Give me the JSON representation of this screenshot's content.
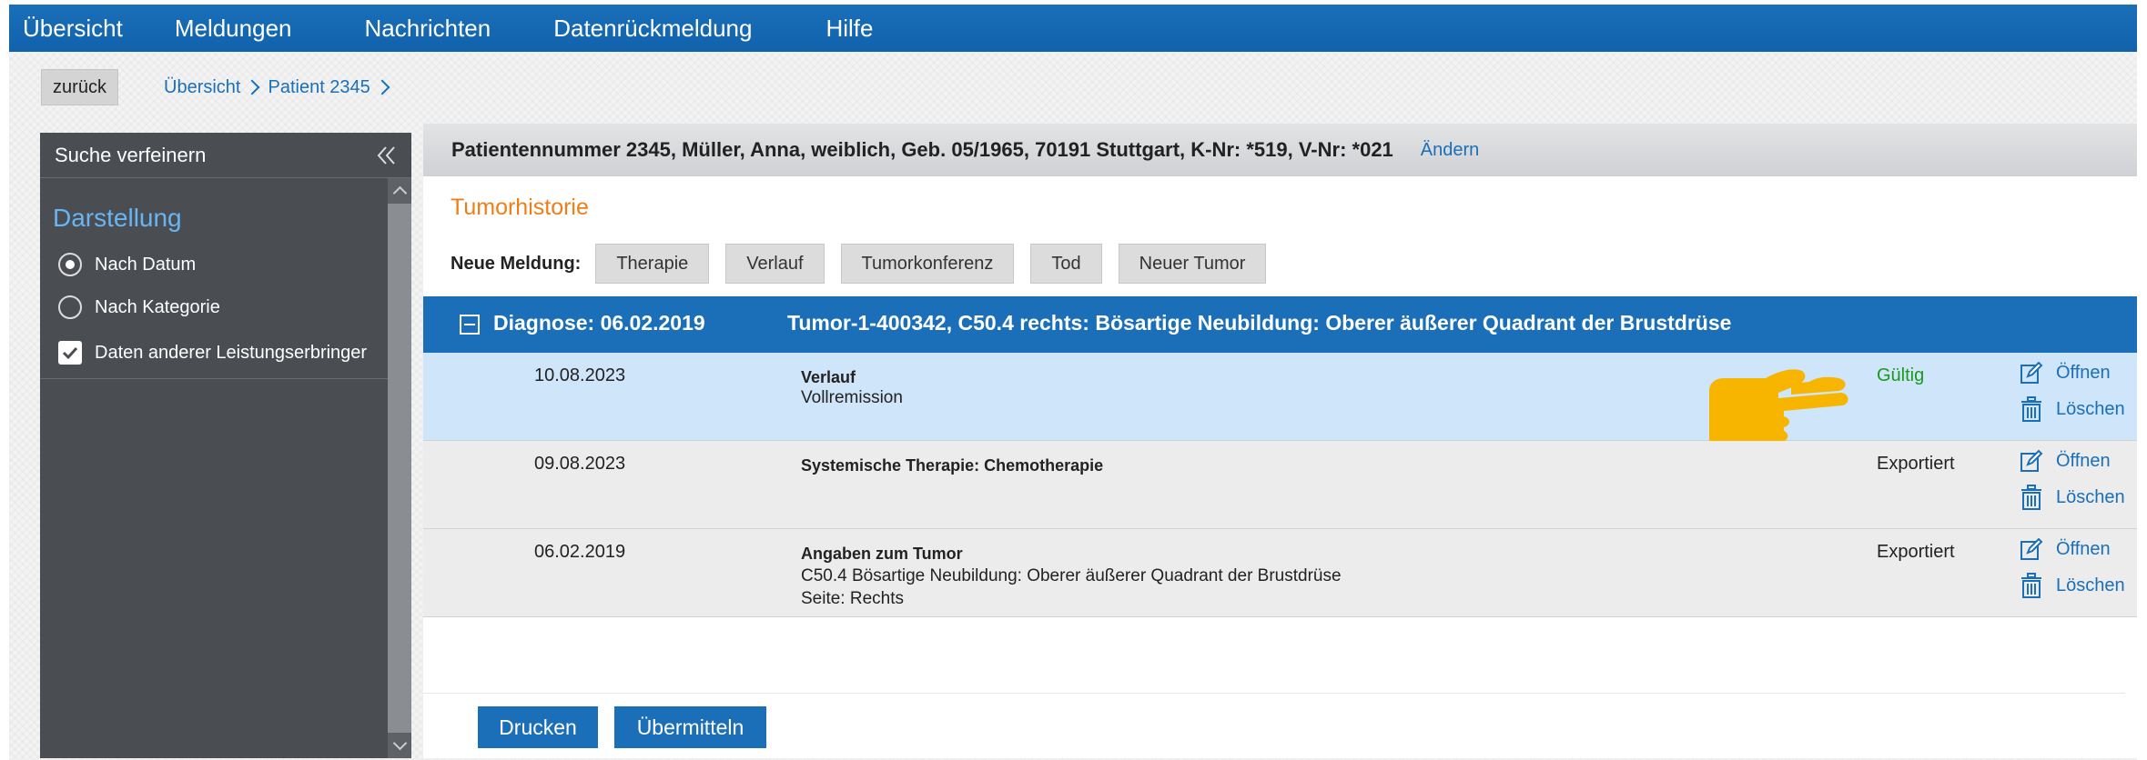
{
  "topnav": {
    "items": [
      {
        "label": "Übersicht"
      },
      {
        "label": "Meldungen"
      },
      {
        "label": "Nachrichten"
      },
      {
        "label": "Datenrückmeldung"
      },
      {
        "label": "Hilfe"
      }
    ]
  },
  "toolbar": {
    "back_label": "zurück",
    "breadcrumb": [
      "Übersicht",
      "Patient 2345"
    ]
  },
  "sidebar": {
    "title": "Suche verfeinern",
    "section_title": "Darstellung",
    "options": [
      {
        "label": "Nach Datum",
        "checked": true
      },
      {
        "label": "Nach Kategorie",
        "checked": false
      }
    ],
    "checkbox": {
      "label": "Daten anderer Leistungserbringer",
      "checked": true
    }
  },
  "patient": {
    "info": "Patientennummer 2345, Müller, Anna, weiblich, Geb. 05/1965, 70191 Stuttgart, K-Nr: *519, V-Nr: *021",
    "edit_label": "Ändern"
  },
  "main": {
    "section_title": "Tumorhistorie",
    "new_report_label": "Neue Meldung:",
    "new_report_buttons": [
      "Therapie",
      "Verlauf",
      "Tumorkonferenz",
      "Tod",
      "Neuer Tumor"
    ]
  },
  "diagnosis": {
    "date_label": "Diagnose: 06.02.2019",
    "description": "Tumor-1-400342, C50.4 rechts: Bösartige Neubildung: Oberer äußerer Quadrant der Brustdrüse"
  },
  "entries": [
    {
      "date": "10.08.2023",
      "title": "Verlauf",
      "lines": [
        "Vollremission"
      ],
      "status": "Gültig",
      "status_color": "#1a9a1a",
      "open_label": "Öffnen",
      "delete_label": "Löschen"
    },
    {
      "date": "09.08.2023",
      "title": "Systemische Therapie: Chemotherapie",
      "lines": [],
      "status": "Exportiert",
      "status_color": "#222222",
      "open_label": "Öffnen",
      "delete_label": "Löschen"
    },
    {
      "date": "06.02.2019",
      "title": "Angaben zum Tumor",
      "lines": [
        "C50.4 Bösartige Neubildung: Oberer äußerer Quadrant der Brustdrüse",
        "Seite: Rechts"
      ],
      "status": "Exportiert",
      "status_color": "#222222",
      "open_label": "Öffnen",
      "delete_label": "Löschen"
    }
  ],
  "footer": {
    "print_label": "Drucken",
    "submit_label": "Übermitteln"
  },
  "colors": {
    "accent_blue": "#1a6fb8",
    "highlight_row": "#cfe5fa",
    "section_orange": "#f07d18",
    "pointer_hand": "#f7b500",
    "sidebar_bg": "#4a4e53"
  }
}
